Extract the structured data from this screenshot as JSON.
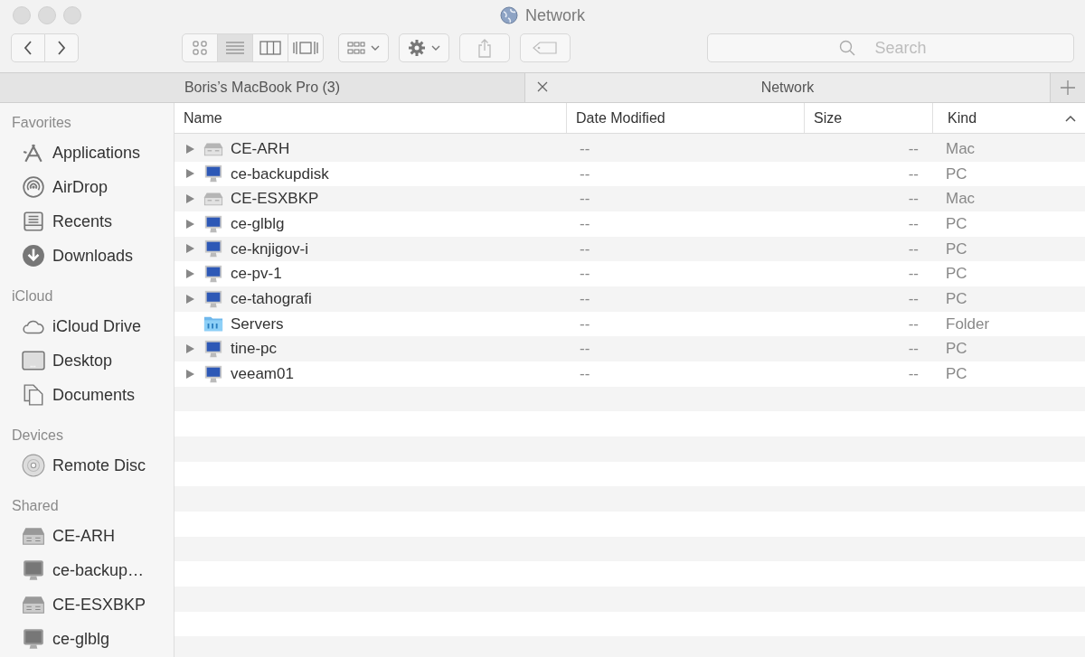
{
  "window": {
    "title": "Network"
  },
  "view_buttons": [
    {
      "kind": "icons",
      "selected": false
    },
    {
      "kind": "list",
      "selected": true
    },
    {
      "kind": "columns",
      "selected": false
    },
    {
      "kind": "cover",
      "selected": false
    }
  ],
  "search": {
    "placeholder": "Search"
  },
  "tabs": [
    {
      "label": "Boris’s MacBook Pro (3)",
      "selected": false
    },
    {
      "label": "Network",
      "selected": true
    }
  ],
  "sidebar": [
    {
      "heading": "Favorites",
      "items": [
        {
          "label": "Applications",
          "kind": "apps"
        },
        {
          "label": "AirDrop",
          "kind": "airdrop"
        },
        {
          "label": "Recents",
          "kind": "recents"
        },
        {
          "label": "Downloads",
          "kind": "downloads"
        }
      ]
    },
    {
      "heading": "iCloud",
      "items": [
        {
          "label": "iCloud Drive",
          "kind": "cloud"
        },
        {
          "label": "Desktop",
          "kind": "desktop"
        },
        {
          "label": "Documents",
          "kind": "documents"
        }
      ]
    },
    {
      "heading": "Devices",
      "items": [
        {
          "label": "Remote Disc",
          "kind": "disc"
        }
      ]
    },
    {
      "heading": "Shared",
      "items": [
        {
          "label": "CE-ARH",
          "kind": "server"
        },
        {
          "label": "ce-backup…",
          "kind": "pc"
        },
        {
          "label": "CE-ESXBKP",
          "kind": "server"
        },
        {
          "label": "ce-glblg",
          "kind": "pc"
        }
      ]
    }
  ],
  "table": {
    "columns": [
      {
        "label": "Name",
        "sorted": false
      },
      {
        "label": "Date Modified",
        "sorted": false
      },
      {
        "label": "Size",
        "sorted": false
      },
      {
        "label": "Kind",
        "sorted": true
      }
    ],
    "rows": [
      {
        "name": "CE-ARH",
        "kind": "server",
        "expandable": true,
        "date": "--",
        "size": "--",
        "type": "Mac"
      },
      {
        "name": "ce-backupdisk",
        "kind": "pc",
        "expandable": true,
        "date": "--",
        "size": "--",
        "type": "PC"
      },
      {
        "name": "CE-ESXBKP",
        "kind": "server",
        "expandable": true,
        "date": "--",
        "size": "--",
        "type": "Mac"
      },
      {
        "name": "ce-glblg",
        "kind": "pc",
        "expandable": true,
        "date": "--",
        "size": "--",
        "type": "PC"
      },
      {
        "name": "ce-knjigov-i",
        "kind": "pc",
        "expandable": true,
        "date": "--",
        "size": "--",
        "type": "PC"
      },
      {
        "name": "ce-pv-1",
        "kind": "pc",
        "expandable": true,
        "date": "--",
        "size": "--",
        "type": "PC"
      },
      {
        "name": "ce-tahografi",
        "kind": "pc",
        "expandable": true,
        "date": "--",
        "size": "--",
        "type": "PC"
      },
      {
        "name": "Servers",
        "kind": "folder",
        "expandable": false,
        "date": "--",
        "size": "--",
        "type": "Folder"
      },
      {
        "name": "tine-pc",
        "kind": "pc",
        "expandable": true,
        "date": "--",
        "size": "--",
        "type": "PC"
      },
      {
        "name": "veeam01",
        "kind": "pc",
        "expandable": true,
        "date": "--",
        "size": "--",
        "type": "PC"
      }
    ]
  }
}
